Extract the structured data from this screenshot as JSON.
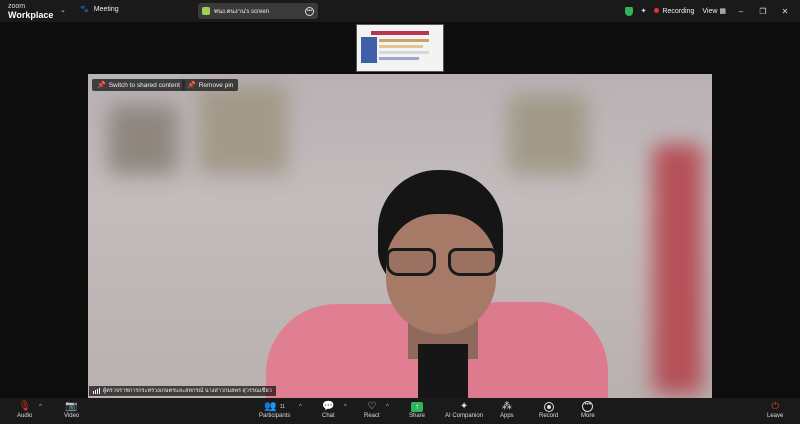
{
  "app": {
    "brand_small": "zoom",
    "brand_big": "Workplace",
    "meeting_label": "Meeting"
  },
  "share_pill": {
    "label": "พนง.คนงาน's screen"
  },
  "top_right": {
    "recording_label": "Recording",
    "view_label": "View"
  },
  "video": {
    "switch_label": "Switch to shared content",
    "remove_pin_label": "Remove pin",
    "participant_name": "ผู้ตรวจราชการกระทรวงเกษตรและสหกรณ์ นางสาวกมลพร สุวรรณเขียว"
  },
  "toolbar": {
    "audio": "Audio",
    "video": "Video",
    "participants": "Participants",
    "participants_count": "11",
    "chat": "Chat",
    "react": "React",
    "share": "Share",
    "ai_companion": "AI Companion",
    "apps": "Apps",
    "record": "Record",
    "more": "More",
    "leave": "Leave"
  },
  "colors": {
    "accent_green": "#2fb45a",
    "record_red": "#e0352b",
    "jacket_pink": "#e07f92"
  },
  "icons": [
    "dropdown-icon",
    "meeting-icon",
    "shield-icon",
    "ai-sparkle-icon",
    "record-dot-icon",
    "pin-icon",
    "signal-icon",
    "mic-muted-icon",
    "camera-off-icon",
    "participants-icon",
    "chat-icon",
    "react-icon",
    "share-icon",
    "ai-companion-icon",
    "apps-icon",
    "record-icon",
    "more-icon",
    "leave-icon"
  ]
}
